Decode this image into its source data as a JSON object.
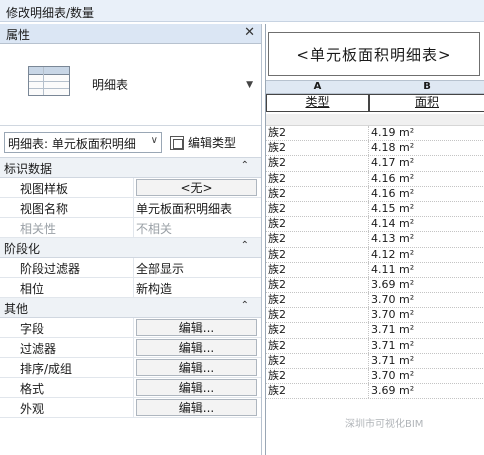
{
  "ribbon": {
    "context_title": "修改明细表/数量"
  },
  "properties": {
    "header": "属性",
    "close_glyph": "✕",
    "type_name": "明细表",
    "instance_selector": "明细表: 单元板面积明细",
    "edit_type_label": "编辑类型",
    "groups": [
      {
        "title": "标识数据",
        "rows": [
          {
            "label": "视图样板",
            "value": "<无>",
            "button": true,
            "disabled": false
          },
          {
            "label": "视图名称",
            "value": "单元板面积明细表",
            "button": false,
            "disabled": false
          },
          {
            "label": "相关性",
            "value": "不相关",
            "button": false,
            "disabled": true
          }
        ]
      },
      {
        "title": "阶段化",
        "rows": [
          {
            "label": "阶段过滤器",
            "value": "全部显示",
            "button": false,
            "disabled": false
          },
          {
            "label": "相位",
            "value": "新构造",
            "button": false,
            "disabled": false
          }
        ]
      },
      {
        "title": "其他",
        "rows": [
          {
            "label": "字段",
            "value": "编辑...",
            "button": true,
            "disabled": false
          },
          {
            "label": "过滤器",
            "value": "编辑...",
            "button": true,
            "disabled": false
          },
          {
            "label": "排序/成组",
            "value": "编辑...",
            "button": true,
            "disabled": false
          },
          {
            "label": "格式",
            "value": "编辑...",
            "button": true,
            "disabled": false
          },
          {
            "label": "外观",
            "value": "编辑...",
            "button": true,
            "disabled": false
          }
        ]
      }
    ]
  },
  "schedule": {
    "title": "<单元板面积明细表>",
    "columns": [
      {
        "letter": "A",
        "header": "类型"
      },
      {
        "letter": "B",
        "header": "面积"
      }
    ],
    "rows": [
      [
        "族2",
        "4.19 m²"
      ],
      [
        "族2",
        "4.18 m²"
      ],
      [
        "族2",
        "4.17 m²"
      ],
      [
        "族2",
        "4.16 m²"
      ],
      [
        "族2",
        "4.16 m²"
      ],
      [
        "族2",
        "4.15 m²"
      ],
      [
        "族2",
        "4.14 m²"
      ],
      [
        "族2",
        "4.13 m²"
      ],
      [
        "族2",
        "4.12 m²"
      ],
      [
        "族2",
        "4.11 m²"
      ],
      [
        "族2",
        "3.69 m²"
      ],
      [
        "族2",
        "3.70 m²"
      ],
      [
        "族2",
        "3.70 m²"
      ],
      [
        "族2",
        "3.71 m²"
      ],
      [
        "族2",
        "3.71 m²"
      ],
      [
        "族2",
        "3.71 m²"
      ],
      [
        "族2",
        "3.70 m²"
      ],
      [
        "族2",
        "3.69 m²"
      ]
    ]
  },
  "watermark": "深圳市可视化BIM"
}
